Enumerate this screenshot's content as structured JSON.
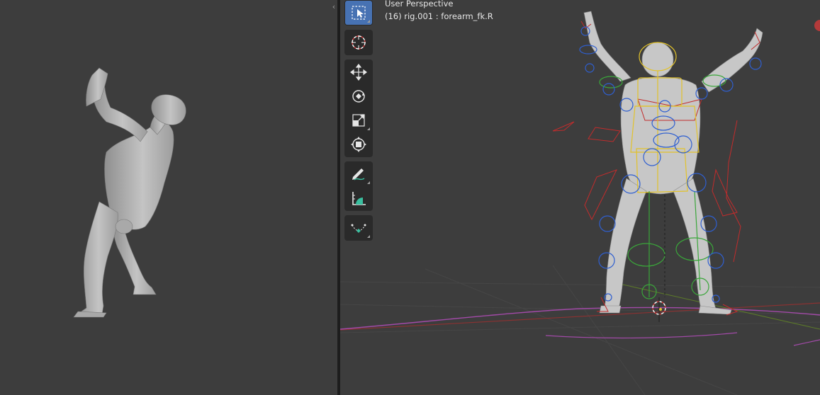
{
  "left_viewport": {
    "figure": "posed-character"
  },
  "right_viewport": {
    "title": "User Perspective",
    "subtitle": "(16) rig.001 : forearm_fk.R",
    "toolbar": [
      {
        "group": "select",
        "tools": [
          {
            "name": "select-box-tool",
            "icon": "select-box-icon",
            "active": true
          }
        ]
      },
      {
        "group": "cursor",
        "tools": [
          {
            "name": "cursor-tool",
            "icon": "cursor-icon",
            "active": false
          }
        ]
      },
      {
        "group": "transform",
        "tools": [
          {
            "name": "move-tool",
            "icon": "move-icon",
            "active": false
          },
          {
            "name": "rotate-tool",
            "icon": "rotate-icon",
            "active": false
          },
          {
            "name": "scale-tool",
            "icon": "scale-icon",
            "active": false
          },
          {
            "name": "transform-tool",
            "icon": "transform-icon",
            "active": false
          }
        ]
      },
      {
        "group": "annotate",
        "tools": [
          {
            "name": "annotate-tool",
            "icon": "annotate-icon",
            "active": false
          },
          {
            "name": "measure-tool",
            "icon": "measure-icon",
            "active": false
          }
        ]
      },
      {
        "group": "bone",
        "tools": [
          {
            "name": "bone-curve-tool",
            "icon": "bone-curve-icon",
            "active": false
          }
        ]
      }
    ]
  },
  "colors": {
    "viewport_bg": "#3d3d3d",
    "toolbar_bg": "#2a2a2a",
    "active_tool": "#4772b3",
    "mesh": "#bdbdbd",
    "bone_blue": "#2f5fd0",
    "bone_yellow": "#e2c22a",
    "bone_green": "#3aa63a",
    "bone_red": "#c42a2a",
    "bone_magenta": "#b04ab8"
  }
}
